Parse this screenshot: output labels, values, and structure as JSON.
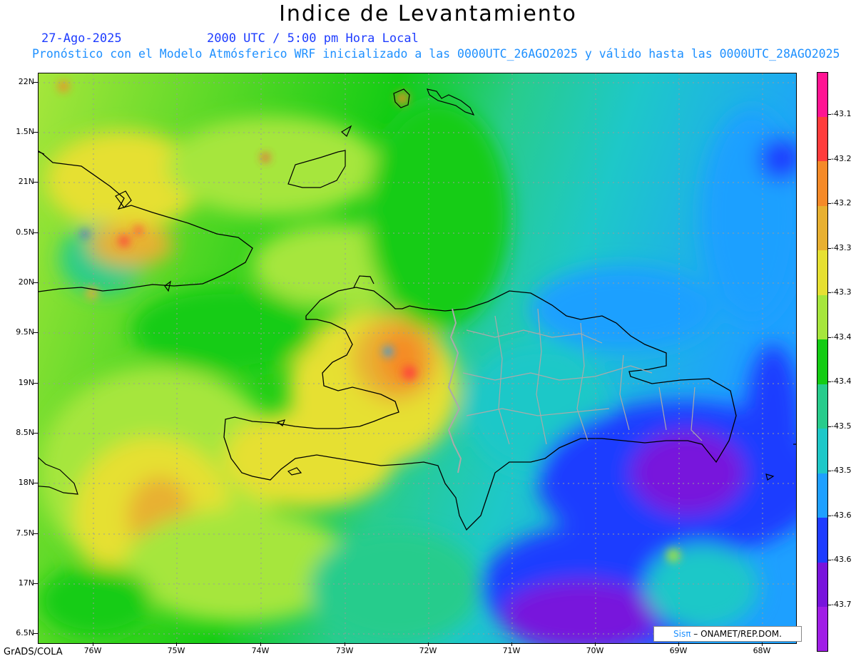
{
  "title": "Indice de Levantamiento",
  "date": "27-Ago-2025",
  "time": "2000 UTC / 5:00 pm Hora Local",
  "description": "Pronóstico con el Modelo Atmósferico WRF inicializado a las 0000UTC_26AGO2025 y válido hasta las  0000UTC_28AGO2025",
  "lat_labels": [
    "22N",
    "1.5N",
    "21N",
    "0.5N",
    "20N",
    "9.5N",
    "19N",
    "8.5N",
    "18N",
    "7.5N",
    "17N",
    "6.5N"
  ],
  "lon_labels": [
    "76W",
    "75W",
    "74W",
    "73W",
    "72W",
    "71W",
    "70W",
    "69W",
    "68W"
  ],
  "colorbar": {
    "labels": [
      "-43.1",
      "-43.2",
      "-43.2",
      "-43.3",
      "-43.3",
      "-43.4",
      "-43.4",
      "-43.5",
      "-43.5",
      "-43.6",
      "-43.6",
      "-43.7"
    ],
    "colors": [
      "#ff1493",
      "#ff3c3c",
      "#f58a28",
      "#e8b030",
      "#e6e032",
      "#a6e63c",
      "#14cc14",
      "#28cc8c",
      "#1ec8c8",
      "#1ea0ff",
      "#1e3cff",
      "#7814dc",
      "#a01ee6"
    ]
  },
  "credit": {
    "sis": "Sisπ",
    "text": "– ONAMET/REP.DOM."
  },
  "software": "GrADS/COLA"
}
